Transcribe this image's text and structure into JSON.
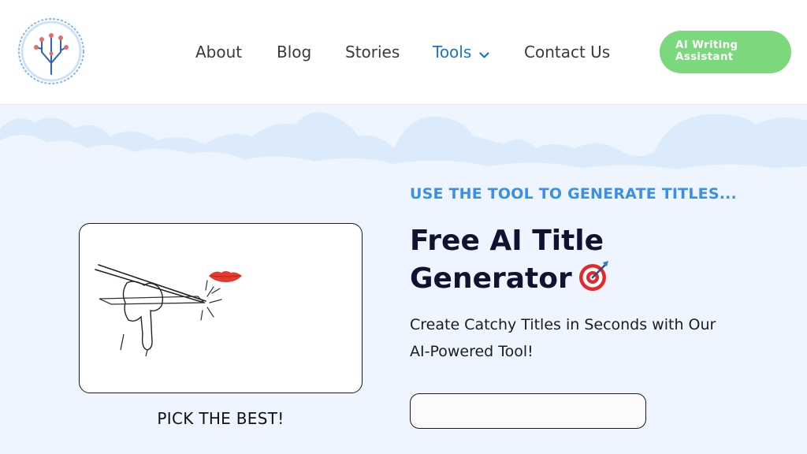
{
  "header": {
    "logo_icon": "neural-tree-logo-icon",
    "nav": [
      {
        "label": "About"
      },
      {
        "label": "Blog"
      },
      {
        "label": "Stories"
      },
      {
        "label": "Tools",
        "active": true,
        "dropdown_icon": "chevron-down-icon"
      },
      {
        "label": "Contact Us"
      }
    ],
    "cta_label": "AI Writing Assistant"
  },
  "hero": {
    "eyebrow": "USE THE TOOL TO GENERATE TITLES...",
    "title": "Free AI Title Generator",
    "title_icon": "target-dart-icon",
    "subtitle": "Create Catchy Titles in Seconds with Our AI-Powered Tool!",
    "card_caption": "PICK THE BEST!",
    "card_image": "hand-holding-chopsticks-lips-illustration",
    "input_value": "",
    "input_placeholder": ""
  },
  "colors": {
    "accent_blue": "#3b8fe8",
    "nav_active": "#1f6fd1",
    "cta_green": "#7bd87c",
    "hero_bg": "#eef5fe",
    "title_dark": "#0e1330"
  }
}
